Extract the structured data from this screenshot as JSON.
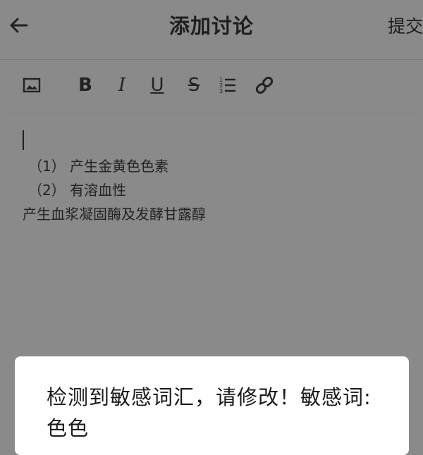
{
  "header": {
    "title": "添加讨论",
    "submit_label": "提交"
  },
  "toolbar": {
    "tools": [
      {
        "name": "image-icon"
      },
      {
        "name": "bold-icon",
        "glyph": "B"
      },
      {
        "name": "italic-icon",
        "glyph": "I"
      },
      {
        "name": "underline-icon",
        "glyph": "U"
      },
      {
        "name": "strikethrough-icon",
        "glyph": "S"
      },
      {
        "name": "ordered-list-icon"
      },
      {
        "name": "link-icon"
      }
    ]
  },
  "editor": {
    "lines": [
      "（1） 产生金黄色色素",
      "（2） 有溶血性",
      "产生血浆凝固酶及发酵甘露醇"
    ]
  },
  "dialog": {
    "message": "检测到敏感词汇，请修改！敏感词: 色色"
  }
}
